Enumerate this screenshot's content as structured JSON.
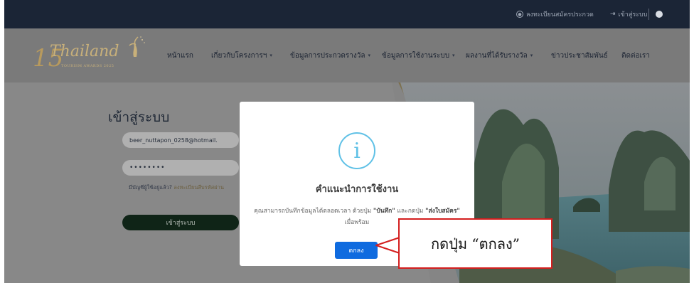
{
  "topbar": {
    "register_label": "ลงทะเบียนสมัครประกวด",
    "login_label": "เข้าสู่ระบบ",
    "facebook_icon": "facebook-icon"
  },
  "brand": {
    "number": "15",
    "name": "Thailand",
    "subtitle": "TOURISM AWARDS 2025"
  },
  "nav": {
    "items": [
      {
        "label": "หน้าแรก",
        "has_dropdown": false
      },
      {
        "label": "เกี่ยวกับโครงการฯ",
        "has_dropdown": true
      },
      {
        "label": "ข้อมูลการประกวดรางวัล",
        "has_dropdown": true
      },
      {
        "label": "ข้อมูลการใช้งานระบบ",
        "has_dropdown": true
      },
      {
        "label": "ผลงานที่ได้รับรางวัล",
        "has_dropdown": true
      },
      {
        "label": "ข่าวประชาสัมพันธ์",
        "has_dropdown": false
      },
      {
        "label": "ติดต่อเรา",
        "has_dropdown": false
      }
    ]
  },
  "login": {
    "title": "เข้าสู่ระบบ",
    "email_value": "beer_nuttapon_0258@hotmail.",
    "password_value": "••••••••",
    "help_text": "มีบัญชีผู้ใช้อยู่แล้ว?",
    "help_link": "ลงทะเบียนสืบรหัสผ่าน",
    "button": "เข้าสู่ระบบ"
  },
  "modal": {
    "icon": "info-icon",
    "title": "คำแนะนำการใช้งาน",
    "body_pre": "คุณสามารถบันทึกข้อมูลได้ตลอดเวลา ด้วยปุ่ม ",
    "body_save": "\"บันทึก\"",
    "body_mid": " และกดปุ่ม ",
    "body_send": "\"ส่งใบสมัคร\"",
    "body_post": " เมื่อพร้อม",
    "ok_button": "ตกลง"
  },
  "callout": {
    "text": "กดปุ่ม “ตกลง”"
  },
  "colors": {
    "topbar_bg": "#1b2536",
    "modal_bg": "#ffffff",
    "ok_button": "#0f6bdf",
    "info_icon": "#60c1e6",
    "callout_border": "#d41e1e",
    "login_button": "#0f2417"
  }
}
